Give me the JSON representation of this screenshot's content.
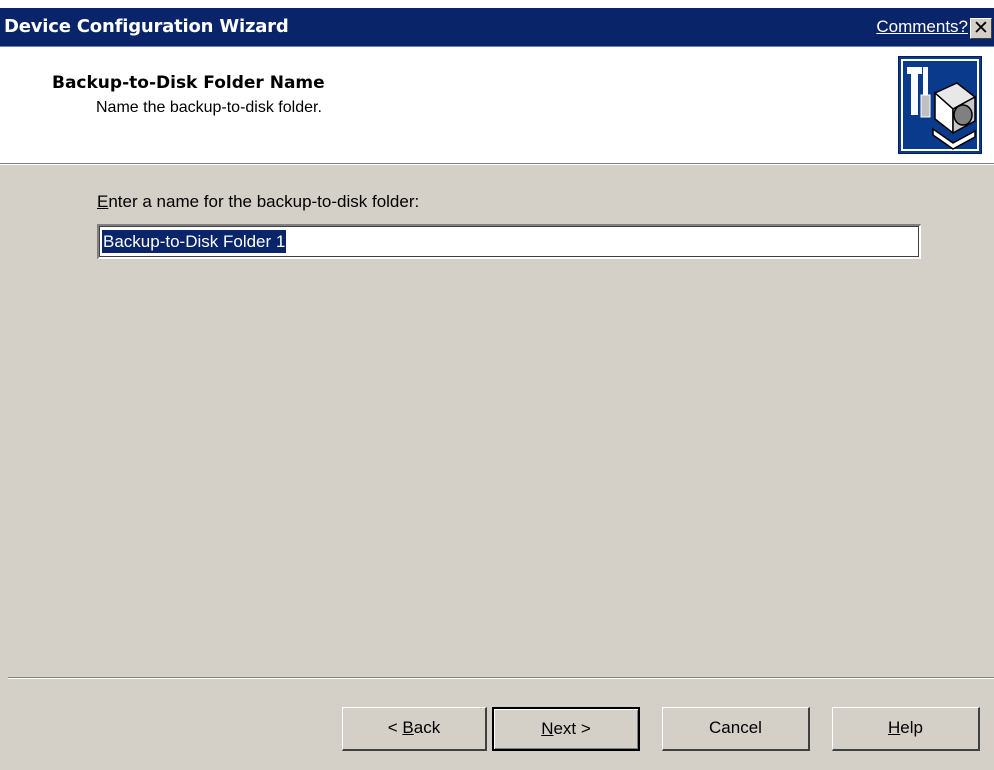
{
  "window": {
    "title": "Device Configuration Wizard",
    "comments_link": "Comments?",
    "close_glyph": "✕"
  },
  "header": {
    "title": "Backup-to-Disk Folder Name",
    "subtitle": "Name the backup-to-disk folder.",
    "icon": "wizard-tools-computer-icon"
  },
  "form": {
    "label_mnemonic": "E",
    "label_rest": "nter a name for the backup-to-disk folder:",
    "folder_name_value": "Backup-to-Disk Folder 1"
  },
  "buttons": {
    "back_prefix": "< ",
    "back_mnemonic": "B",
    "back_rest": "ack",
    "next_mnemonic": "N",
    "next_rest": "ext >",
    "cancel": "Cancel",
    "help_mnemonic": "H",
    "help_rest": "elp"
  },
  "colors": {
    "titlebar": "#0a246a",
    "dialog_face": "#d4d0c8",
    "selection": "#0a246a"
  }
}
